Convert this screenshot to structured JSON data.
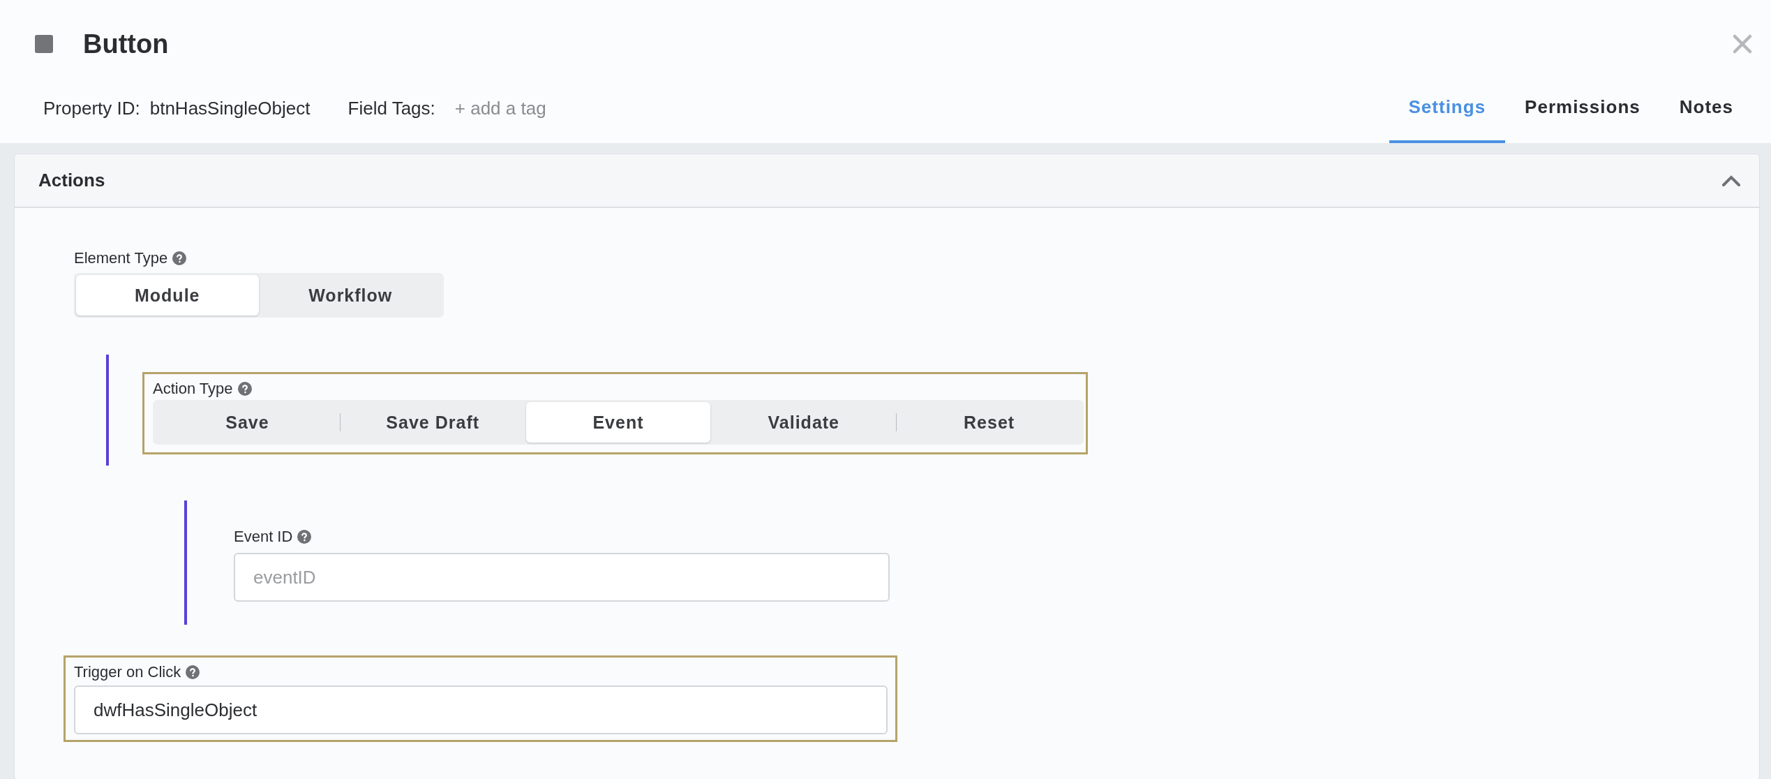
{
  "header": {
    "title": "Button",
    "property_id_label": "Property ID:",
    "property_id": "btnHasSingleObject",
    "field_tags_label": "Field Tags:",
    "add_tag": "+ add a tag"
  },
  "tabs": [
    {
      "label": "Settings",
      "selected": true
    },
    {
      "label": "Permissions",
      "selected": false
    },
    {
      "label": "Notes",
      "selected": false
    }
  ],
  "panel": {
    "title": "Actions",
    "expanded": true,
    "element_type": {
      "label": "Element Type",
      "highlighted": false,
      "options": [
        {
          "label": "Module",
          "selected": true
        },
        {
          "label": "Workflow",
          "selected": false
        }
      ]
    },
    "action_type": {
      "label": "Action Type",
      "highlighted": true,
      "options": [
        {
          "label": "Save",
          "selected": false
        },
        {
          "label": "Save Draft",
          "selected": false
        },
        {
          "label": "Event",
          "selected": true
        },
        {
          "label": "Validate",
          "selected": false
        },
        {
          "label": "Reset",
          "selected": false
        }
      ]
    },
    "event_id": {
      "label": "Event ID",
      "highlighted": false,
      "placeholder": "eventID"
    },
    "trigger_on_click": {
      "label": "Trigger on Click",
      "highlighted": true,
      "value": "dwfHasSingleObject"
    }
  }
}
